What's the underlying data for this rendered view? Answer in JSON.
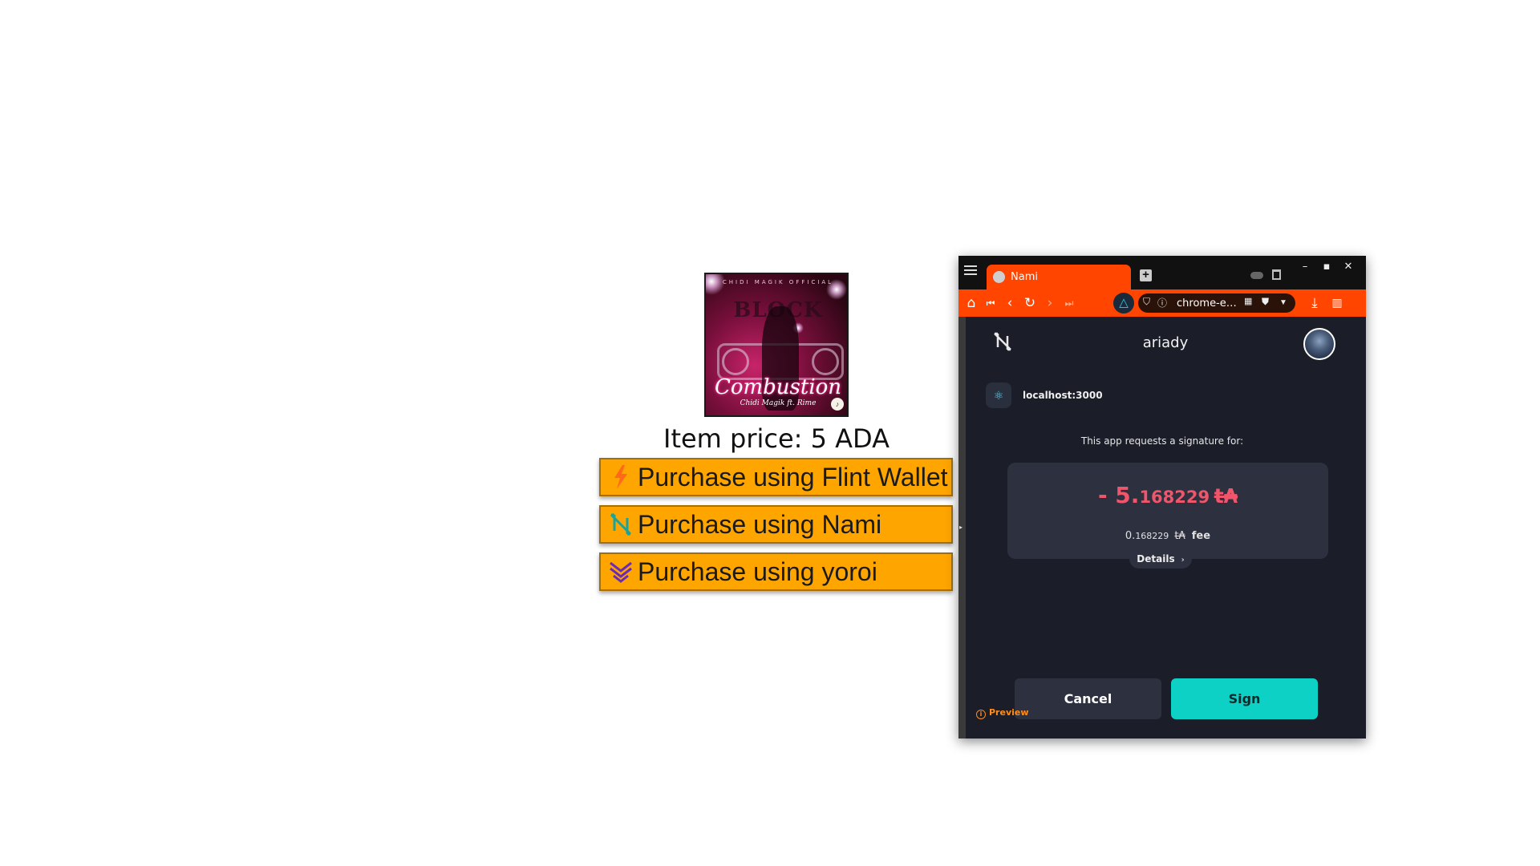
{
  "product": {
    "cover": {
      "top_text": "CHIDI MAGIK OFFICIAL",
      "big_text": "BLOCK",
      "title": "Combustion",
      "artist": "Chidi Magik ft. Rime"
    },
    "price_text": "Item price: 5 ADA",
    "buttons": [
      {
        "label": "Purchase using Flint Wallet",
        "icon": "flint-icon"
      },
      {
        "label": "Purchase using Nami",
        "icon": "nami-icon"
      },
      {
        "label": "Purchase using yoroi",
        "icon": "yoroi-icon"
      }
    ]
  },
  "popup": {
    "tab_title": "Nami",
    "address": "chrome-e…",
    "account_name": "ariady",
    "origin": "localhost:3000",
    "request_text": "This app requests a signature for:",
    "amount": {
      "prefix": "- 5.",
      "decimals": "168229",
      "unit": "t₳"
    },
    "fee": {
      "prefix": "0.",
      "decimals": "168229",
      "unit": "t₳",
      "label": "fee"
    },
    "details_label": "Details",
    "preview_label": "Preview",
    "cancel_label": "Cancel",
    "sign_label": "Sign"
  },
  "colors": {
    "purchase_button": "#ffa500",
    "toolbar": "#ff4500",
    "sign_button": "#0ed1c5",
    "amount": "#f0566b",
    "popup_bg": "#1b1e29"
  }
}
